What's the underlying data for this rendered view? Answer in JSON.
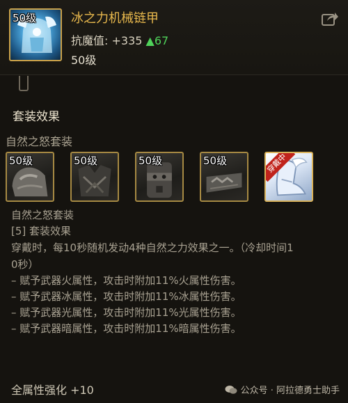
{
  "item": {
    "icon_level": "50级",
    "name": "冰之力机械链甲",
    "stat_label": "抗魔值:",
    "stat_value": "+335",
    "stat_arrow": "▲",
    "stat_increase": "67",
    "level": "50级",
    "icon": "armor-icon"
  },
  "set": {
    "title": "套装效果",
    "name": "自然之怒套装",
    "slots": [
      {
        "level": "50级",
        "icon": "shoulder-icon",
        "equipped": false
      },
      {
        "level": "50级",
        "icon": "chest-icon",
        "equipped": false
      },
      {
        "level": "50级",
        "icon": "belt-icon",
        "equipped": false
      },
      {
        "level": "50级",
        "icon": "leg-icon",
        "equipped": false
      },
      {
        "level": "",
        "icon": "boot-icon",
        "equipped": true,
        "badge": "穿戴中"
      }
    ],
    "effect_name": "自然之怒套装",
    "effect_tier": "[5] 套装效果",
    "effect_desc": "穿戴时，每10秒随机发动4种自然之力效果之一。（冷却时间1",
    "effect_desc_cont": "0秒）",
    "effects": [
      "– 赋予武器火属性，攻击时附加11%火属性伤害。",
      "– 赋予武器冰属性，攻击时附加11%冰属性伤害。",
      "– 赋予武器光属性，攻击时附加11%光属性伤害。",
      "– 赋予武器暗属性，攻击时附加11%暗属性伤害。"
    ]
  },
  "footer": {
    "all_stat": "全属性强化 +10",
    "watermark": "公众号 · 阿拉德勇士助手"
  },
  "colors": {
    "title_gold": "#e9b94d",
    "increase_green": "#4fd25a",
    "slot_border": "#a78a43",
    "badge_red": "#c0231c"
  }
}
